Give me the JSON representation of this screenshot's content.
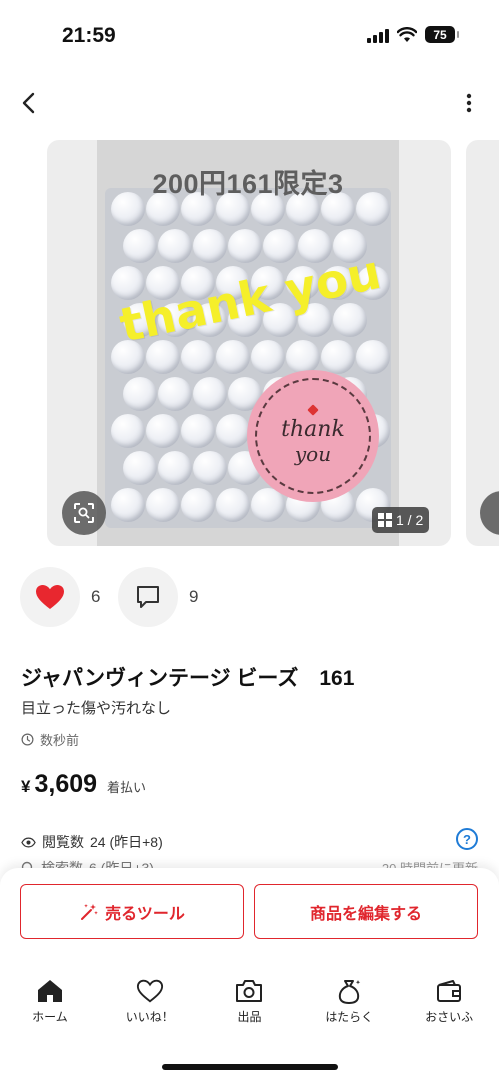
{
  "status_bar": {
    "time": "21:59",
    "battery": "75",
    "icons": [
      "signal-icon",
      "wifi-icon",
      "battery-icon"
    ]
  },
  "nav": {
    "back_icon": "chevron-left-icon",
    "more_icon": "more-vertical-icon"
  },
  "gallery": {
    "overlay_text": "200円161限定3",
    "thank_text": "thank you",
    "sticker_line1": "thank",
    "sticker_line2": "you",
    "page_indicator": "1 / 2",
    "current_page": 1,
    "total_pages": 2
  },
  "actions": {
    "like_count": "6",
    "comment_count": "9"
  },
  "item": {
    "title": "ジャパンヴィンテージ ビーズ　161",
    "condition": "目立った傷や汚れなし",
    "posted": "数秒前",
    "price_symbol": "¥",
    "price": "3,609",
    "shipping": "着払い"
  },
  "stats": {
    "views_label": "閲覧数",
    "views_value": "24 (昨日+8)",
    "search_label": "検索数",
    "search_value": "6 (昨日+3)",
    "updated": "20 時間前に更新"
  },
  "buttons": {
    "sell_tools": "売るツール",
    "edit_item": "商品を編集する"
  },
  "tabbar": {
    "items": [
      {
        "label": "ホーム",
        "icon": "home-icon"
      },
      {
        "label": "いいね！",
        "icon": "heart-icon"
      },
      {
        "label": "出品",
        "icon": "camera-icon"
      },
      {
        "label": "はたらく",
        "icon": "money-bag-icon"
      },
      {
        "label": "おさいふ",
        "icon": "wallet-icon"
      }
    ]
  },
  "colors": {
    "accent_red": "#e0262d",
    "heart_red": "#e8272f",
    "help_blue": "#1e7bd6"
  }
}
